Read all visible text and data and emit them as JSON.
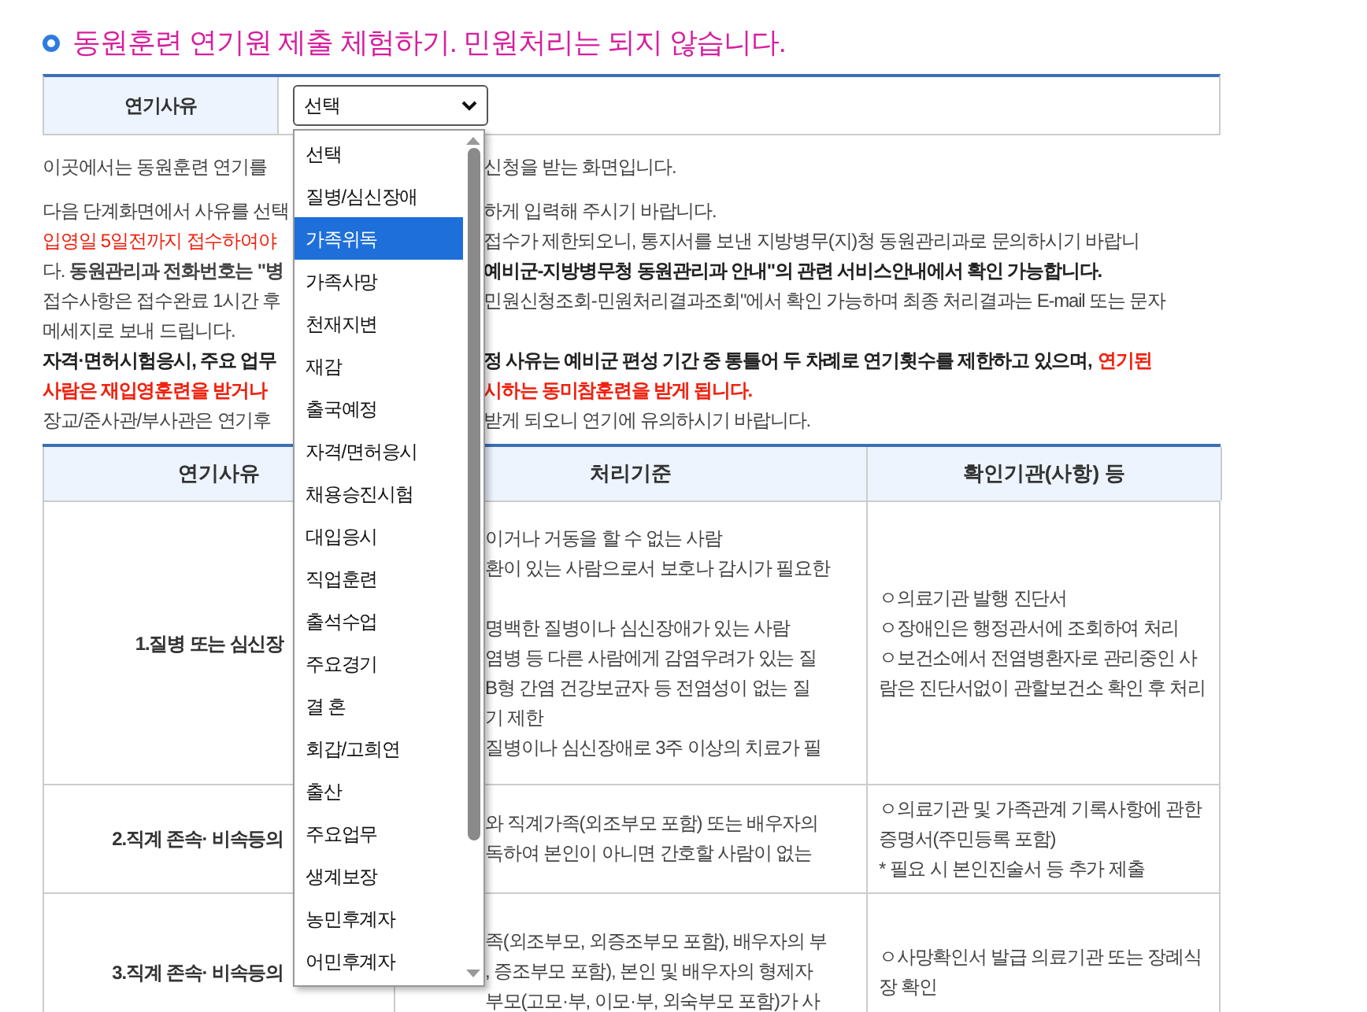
{
  "title": "동원훈련 연기원 제출 체험하기. 민원처리는 되지 않습니다.",
  "form": {
    "label": "연기사유",
    "select_value": "선택"
  },
  "dropdown": {
    "options": [
      {
        "label": "선택",
        "selected": false
      },
      {
        "label": "질병/심신장애",
        "selected": false
      },
      {
        "label": "가족위독",
        "selected": true
      },
      {
        "label": "가족사망",
        "selected": false
      },
      {
        "label": "천재지변",
        "selected": false
      },
      {
        "label": "재감",
        "selected": false
      },
      {
        "label": "출국예정",
        "selected": false
      },
      {
        "label": "자격/면허응시",
        "selected": false
      },
      {
        "label": "채용승진시험",
        "selected": false
      },
      {
        "label": "대입응시",
        "selected": false
      },
      {
        "label": "직업훈련",
        "selected": false
      },
      {
        "label": "출석수업",
        "selected": false
      },
      {
        "label": "주요경기",
        "selected": false
      },
      {
        "label": "결 혼",
        "selected": false
      },
      {
        "label": "회갑/고희연",
        "selected": false
      },
      {
        "label": "출산",
        "selected": false
      },
      {
        "label": "주요업무",
        "selected": false
      },
      {
        "label": "생계보장",
        "selected": false
      },
      {
        "label": "농민후계자",
        "selected": false
      },
      {
        "label": "어민후계자",
        "selected": false
      }
    ]
  },
  "notice_paragraphs": [
    [
      {
        "left": {
          "text": "이곳에서는 동원훈련 연기를",
          "kind": "plain"
        },
        "right": [
          {
            "text": "신청을 받는 화면입니다.",
            "kind": "plain"
          }
        ]
      }
    ],
    [
      {
        "left": {
          "text": "다음 단계화면에서 사유를 선택",
          "kind": "plain"
        },
        "right": [
          {
            "text": "하게 입력해 주시기 바랍니다.",
            "kind": "plain"
          }
        ]
      },
      {
        "left": {
          "text": "입영일 5일전까지 접수하여야",
          "kind": "red"
        },
        "right": [
          {
            "text": "접수가 제한되오니, 통지서를 보낸 지방병무(지)청 동원관리과로 문의하시기 바랍니",
            "kind": "plain"
          }
        ]
      },
      {
        "left": {
          "text": "다. **동원관리과 전화번호는 \"병**",
          "kind": "plain"
        },
        "right": [
          {
            "text": "예비군-지방병무청 동원관리과 안내\"의 관련 서비스안내에서 확인 가능합니다.",
            "kind": "bold"
          }
        ]
      },
      {
        "left": {
          "text": "접수사항은 접수완료 1시간 후",
          "kind": "plain"
        },
        "right": [
          {
            "text": "민원신청조회-민원처리결과조회\"에서 확인 가능하며 최종 처리결과는 E-mail 또는 문자",
            "kind": "plain"
          }
        ]
      },
      {
        "left": {
          "text": "메세지로 보내 드립니다.",
          "kind": "plain"
        }
      },
      {
        "left": {
          "text": "자격·면허시험응시, 주요 업무",
          "kind": "bold"
        },
        "right": [
          {
            "text": "정 사유는 예비군 편성 기간 중 통틀어 두 차례로 연기횟수를 제한하고 있으며,",
            "kind": "bold"
          },
          {
            "text": "연기된",
            "kind": "redbold"
          }
        ]
      },
      {
        "left": {
          "text": "사람은 재입영훈련을 받거나",
          "kind": "redbold"
        },
        "right": [
          {
            "text": "시하는 동미참훈련을 받게 됩니다.",
            "kind": "redbold"
          }
        ]
      },
      {
        "left": {
          "text": "장교/준사관/부사관은 연기후",
          "kind": "plain"
        },
        "right": [
          {
            "text": "받게 되오니 연기에 유의하시기 바랍니다.",
            "kind": "plain"
          }
        ]
      }
    ]
  ],
  "table": {
    "columns": [
      "연기사유",
      "처리기준",
      "확인기관(사항) 등"
    ],
    "rows": [
      {
        "reason": "1.질병 또는 심신장",
        "criteria": [
          [
            "이거나 거동을 할 수 없는 사람",
            "환이 있는 사람으로서 보호나 감시가 필요한"
          ],
          [
            "명백한 질병이나 심신장애가 있는 사람",
            "염병 등 다른 사람에게 감염우려가 있는 질",
            "B형 간염 건강보균자 등 전염성이 없는 질",
            "기 제한",
            "질병이나 심신장애로 3주 이상의 치료가 필"
          ]
        ],
        "verification": [
          "ㅇ의료기관 발행 진단서",
          "ㅇ장애인은 행정관서에 조회하여 처리",
          "ㅇ보건소에서 전염병환자로 관리중인 사람은 진단서없이 관할보건소 확인 후 처리"
        ]
      },
      {
        "reason": "2.직계 존속· 비속등의",
        "criteria": [
          [
            "와 직계가족(외조부모 포함) 또는 배우자의",
            "독하여 본인이 아니면 간호할 사람이 없는"
          ]
        ],
        "verification": [
          "ㅇ의료기관 및 가족관계 기록사항에 관한 증명서(주민등록 포함)",
          "* 필요 시 본인진술서 등 추가 제출"
        ]
      },
      {
        "reason": "3.직계 존속· 비속등의",
        "criteria": [
          [
            "족(외조부모, 외증조부모 포함), 배우자의 부",
            ", 증조부모 포함), 본인 및 배우자의 형제자",
            "부모(고모·부, 이모·부, 외숙부모 포함)가 사"
          ]
        ],
        "verification": [
          "ㅇ사망확인서 발급 의료기관 또는 장례식장 확인"
        ]
      }
    ]
  }
}
